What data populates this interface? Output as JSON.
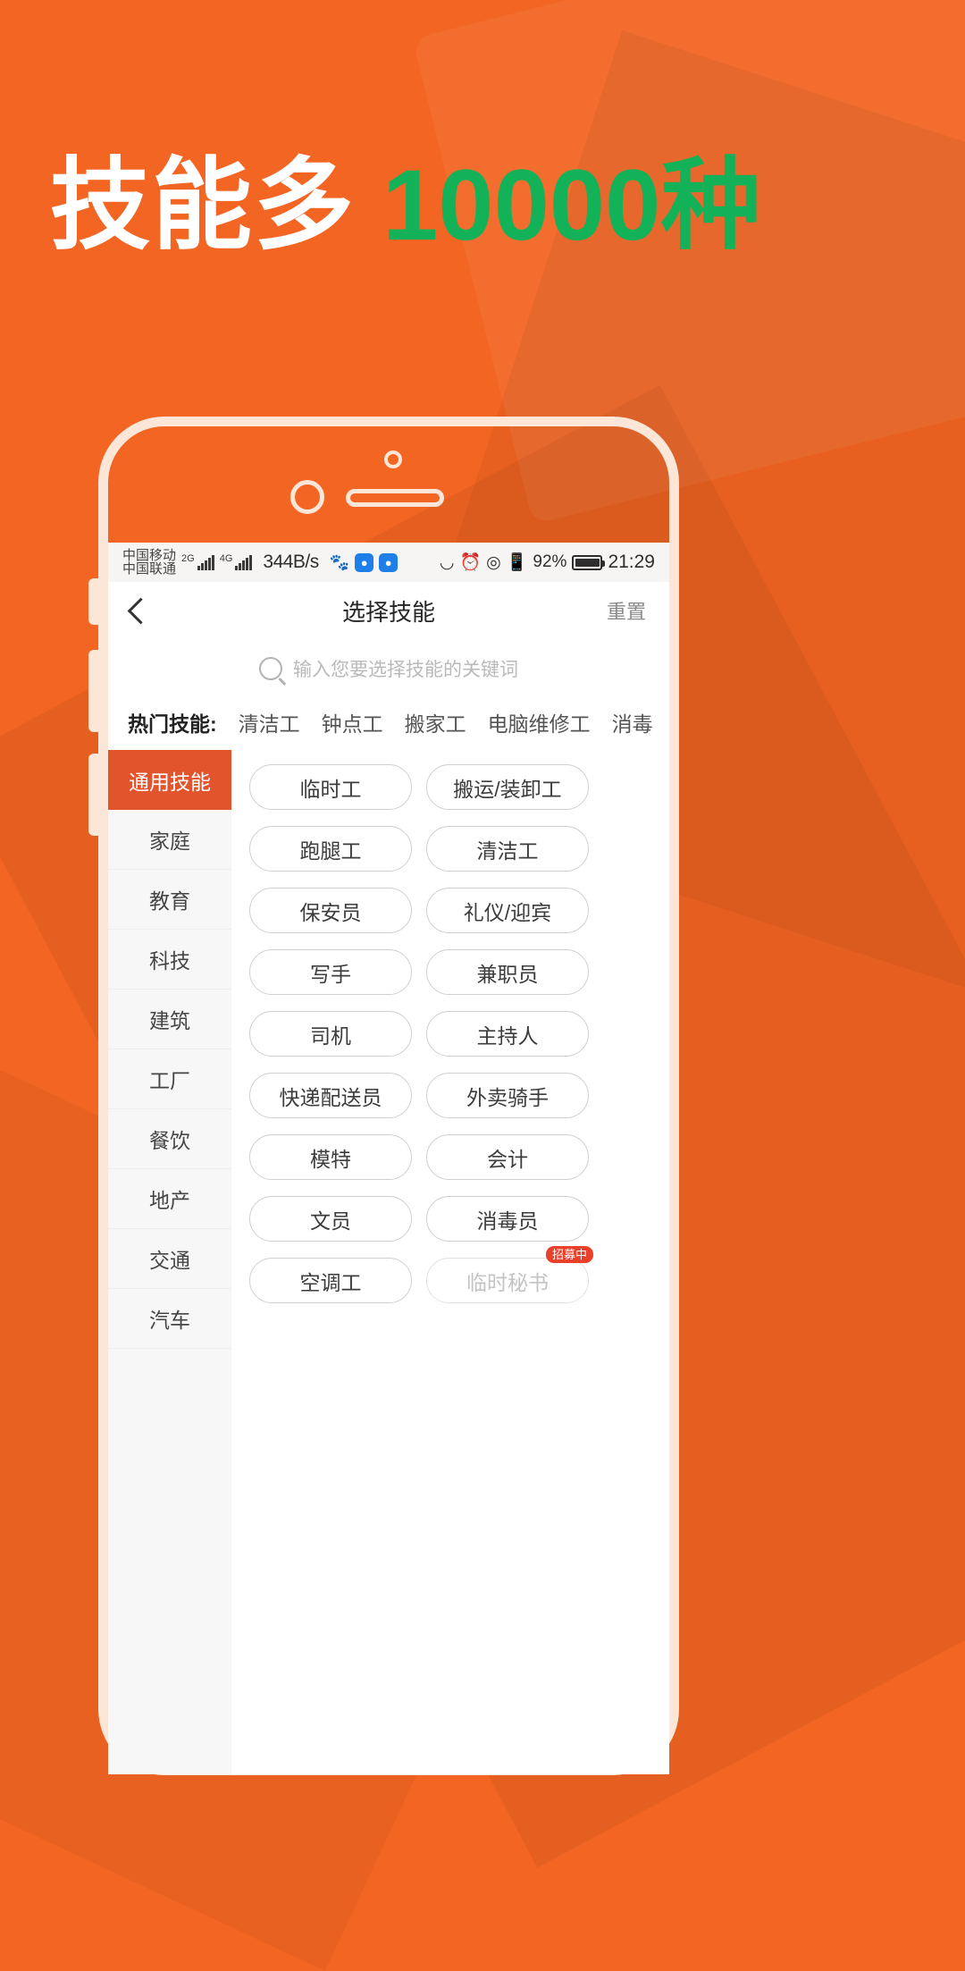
{
  "poster": {
    "headline_white": "技能多",
    "headline_green": "10000种",
    "bg_color": "#F26522",
    "accent_green": "#13B259"
  },
  "statusbar": {
    "carrier_1": "中国移动",
    "carrier_2": "中国联通",
    "net_tag_1": "2G",
    "net_tag_2": "4G",
    "net_speed": "344B/s",
    "battery_percent": "92%",
    "clock": "21:29",
    "icons": [
      "shield-icon",
      "lamp-icon",
      "headphone-icon",
      "alarm-icon",
      "location-icon",
      "vibrate-icon"
    ]
  },
  "navbar": {
    "back_icon": "chevron-left-icon",
    "title": "选择技能",
    "reset_label": "重置"
  },
  "search": {
    "icon": "search-icon",
    "placeholder": "输入您要选择技能的关键词"
  },
  "hot_skills": {
    "label": "热门技能:",
    "items": [
      "清洁工",
      "钟点工",
      "搬家工",
      "电脑维修工",
      "消毒"
    ]
  },
  "sidebar": {
    "active_index": 0,
    "items": [
      {
        "label": "通用技能"
      },
      {
        "label": "家庭"
      },
      {
        "label": "教育"
      },
      {
        "label": "科技"
      },
      {
        "label": "建筑"
      },
      {
        "label": "工厂"
      },
      {
        "label": "餐饮"
      },
      {
        "label": "地产"
      },
      {
        "label": "交通"
      },
      {
        "label": "汽车"
      }
    ]
  },
  "skills": {
    "chips": [
      {
        "label": "临时工"
      },
      {
        "label": "搬运/装卸工"
      },
      {
        "label": "跑腿工"
      },
      {
        "label": "清洁工"
      },
      {
        "label": "保安员"
      },
      {
        "label": "礼仪/迎宾"
      },
      {
        "label": "写手"
      },
      {
        "label": "兼职员"
      },
      {
        "label": "司机"
      },
      {
        "label": "主持人"
      },
      {
        "label": "快递配送员"
      },
      {
        "label": "外卖骑手"
      },
      {
        "label": "模特"
      },
      {
        "label": "会计"
      },
      {
        "label": "文员"
      },
      {
        "label": "消毒员"
      },
      {
        "label": "空调工"
      },
      {
        "label": "临时秘书",
        "muted": true,
        "badge": "招募中"
      }
    ]
  }
}
